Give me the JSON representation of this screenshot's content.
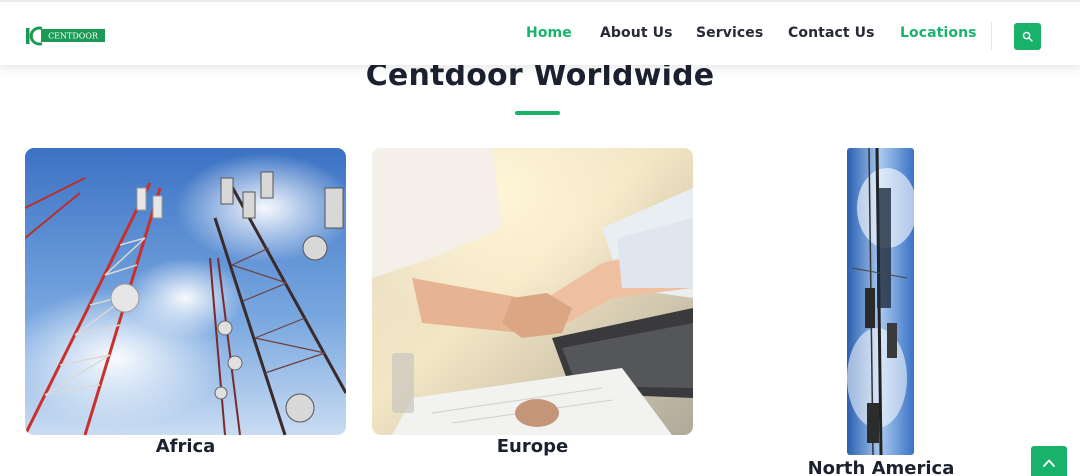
{
  "header": {
    "logo_text": "CENTDOOR",
    "nav": [
      {
        "label": "Home"
      },
      {
        "label": "About Us"
      },
      {
        "label": "Services"
      },
      {
        "label": "Contact Us"
      },
      {
        "label": "Locations"
      }
    ],
    "search_icon": "search-icon"
  },
  "main": {
    "title": "Centdoor Worldwide",
    "regions": [
      {
        "label": "Africa",
        "image": "telecom-towers"
      },
      {
        "label": "Europe",
        "image": "handshake"
      },
      {
        "label": "North America",
        "image": "cell-tower"
      }
    ]
  },
  "scroll_top_icon": "chevron-up-icon",
  "colors": {
    "accent": "#19b26b",
    "text": "#1c2130",
    "nav_text": "#262a35"
  }
}
